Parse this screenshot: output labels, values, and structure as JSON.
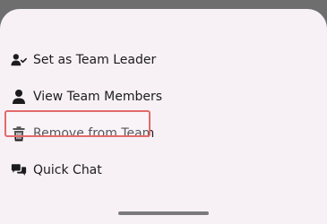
{
  "menu": {
    "items": [
      {
        "label": "Set as Team Leader",
        "icon": "user-check-icon"
      },
      {
        "label": "View Team Members",
        "icon": "user-icon"
      },
      {
        "label": "Remove from Team",
        "icon": "trash-icon"
      },
      {
        "label": "Quick Chat",
        "icon": "chat-bubbles-icon"
      }
    ]
  },
  "colors": {
    "sheet_background": "#f7f1f6",
    "highlight_border": "#e36a6a",
    "text": "#1c1b1f"
  }
}
